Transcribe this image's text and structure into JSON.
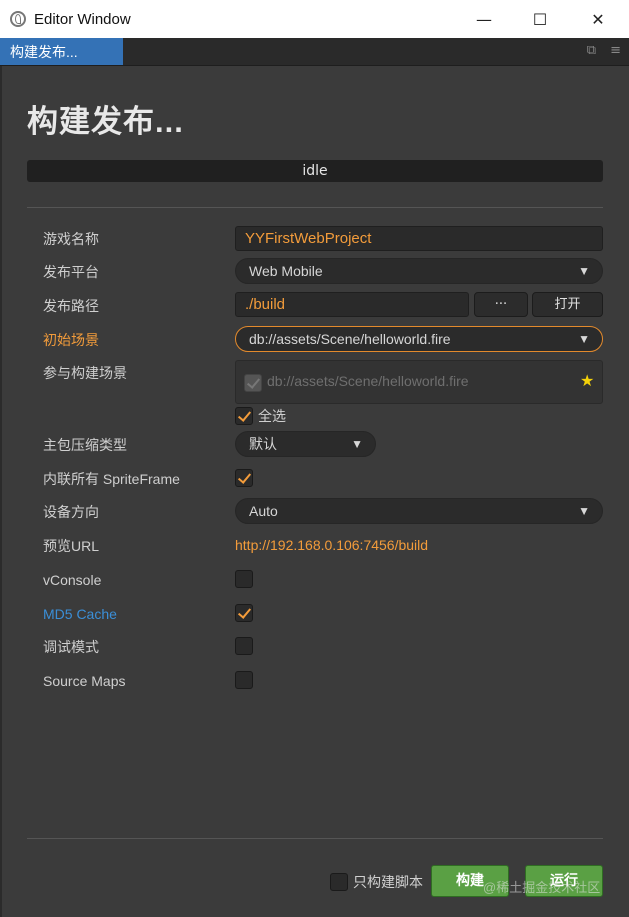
{
  "window": {
    "title": "Editor Window",
    "minimize": "—",
    "maximize": "☐",
    "close": "✕"
  },
  "tab": {
    "label": "构建发布...",
    "icon_popout": "⧉",
    "icon_menu": "≡"
  },
  "page": {
    "title": "构建发布...",
    "status": "idle"
  },
  "form": {
    "game_name": {
      "label": "游戏名称",
      "value": "YYFirstWebProject"
    },
    "platform": {
      "label": "发布平台",
      "value": "Web Mobile"
    },
    "build_path": {
      "label": "发布路径",
      "value": "./build",
      "browse": "···",
      "open": "打开"
    },
    "start_scene": {
      "label": "初始场景",
      "value": "db://assets/Scene/helloworld.fire"
    },
    "included_scenes": {
      "label": "参与构建场景",
      "items": [
        "db://assets/Scene/helloworld.fire"
      ],
      "select_all": "全选"
    },
    "compression": {
      "label": "主包压缩类型",
      "value": "默认"
    },
    "inline_spriteframe": {
      "label": "内联所有 SpriteFrame",
      "checked": true
    },
    "orientation": {
      "label": "设备方向",
      "value": "Auto"
    },
    "preview_url": {
      "label": "预览URL",
      "value": "http://192.168.0.106:7456/build"
    },
    "vconsole": {
      "label": "vConsole",
      "checked": false
    },
    "md5_cache": {
      "label": "MD5 Cache",
      "checked": true
    },
    "debug_mode": {
      "label": "调试模式",
      "checked": false
    },
    "source_maps": {
      "label": "Source Maps",
      "checked": false
    }
  },
  "footer": {
    "build_script_only": "只构建脚本",
    "build": "构建",
    "run": "运行",
    "watermark": "@稀土掘金技术社区"
  },
  "colors": {
    "accent": "#f39c3b",
    "tab": "#3472b6",
    "button_green": "#5aa044",
    "link_blue": "#3b8fd8"
  }
}
